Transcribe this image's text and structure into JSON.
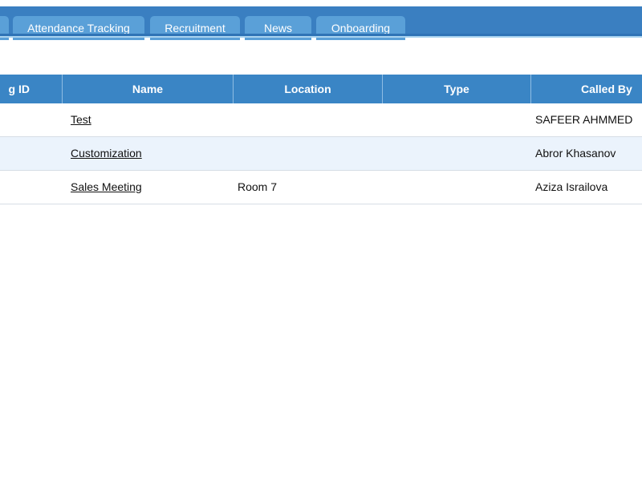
{
  "tabs": [
    {
      "label": ""
    },
    {
      "label": "Attendance Tracking"
    },
    {
      "label": "Recruitment"
    },
    {
      "label": "News"
    },
    {
      "label": "Onboarding"
    }
  ],
  "table": {
    "columns": [
      "g ID",
      "Name",
      "Location",
      "Type",
      "Called By"
    ],
    "rows": [
      {
        "name": "Test",
        "location": "",
        "type": "",
        "called_by": "SAFEER AHMMED"
      },
      {
        "name": "Customization",
        "location": "",
        "type": "",
        "called_by": "Abror Khasanov"
      },
      {
        "name": "Sales Meeting",
        "location": "Room 7",
        "type": "",
        "called_by": "Aziza Israilova"
      }
    ]
  },
  "colors": {
    "tabbar": "#3a7fc1",
    "tab": "#5aa0d8",
    "header": "#3a85c5",
    "row_alt": "#ebf3fc"
  }
}
